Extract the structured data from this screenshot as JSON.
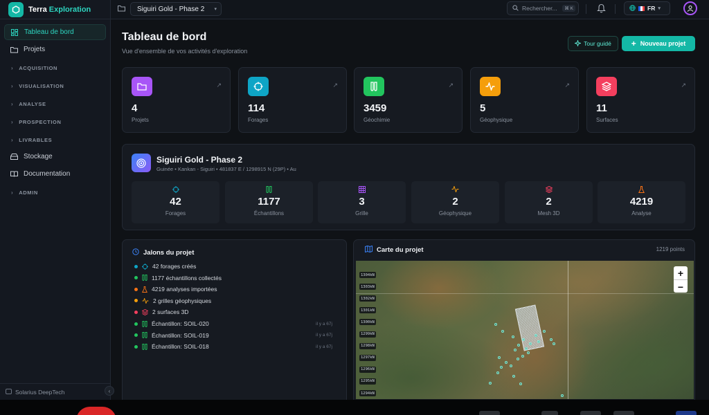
{
  "brand": {
    "name_part1": "Terra",
    "name_part2": "Exploration"
  },
  "sidebar": {
    "items": [
      {
        "label": "Tableau de bord",
        "icon": "dashboard-icon",
        "active": true
      },
      {
        "label": "Projets",
        "icon": "folder-icon",
        "active": false
      }
    ],
    "sections": [
      "ACQUISITION",
      "VISUALISATION",
      "ANALYSE",
      "PROSPECTION",
      "LIVRABLES"
    ],
    "bottom_items": [
      {
        "label": "Stockage",
        "icon": "storage-icon"
      },
      {
        "label": "Documentation",
        "icon": "book-icon"
      }
    ],
    "admin_section": "ADMIN",
    "footer": "Solarius DeepTech"
  },
  "topbar": {
    "project_selector": "Siguiri Gold - Phase 2",
    "search_placeholder": "Rechercher...",
    "search_shortcut": "⌘ K",
    "language": "FR"
  },
  "header": {
    "title": "Tableau de bord",
    "subtitle": "Vue d'ensemble de vos activités d'exploration",
    "tour_button": "Tour guidé",
    "new_project_button": "Nouveau projet"
  },
  "stats": [
    {
      "value": "4",
      "label": "Projets",
      "icon": "folder-icon",
      "color": "#a855f7"
    },
    {
      "value": "114",
      "label": "Forages",
      "icon": "target-icon",
      "color": "#0ea5c6"
    },
    {
      "value": "3459",
      "label": "Géochimie",
      "icon": "sample-tubes-icon",
      "color": "#22c55e"
    },
    {
      "value": "5",
      "label": "Géophysique",
      "icon": "pulse-icon",
      "color": "#f59e0b"
    },
    {
      "value": "11",
      "label": "Surfaces",
      "icon": "layers-icon",
      "color": "#f43f5e"
    }
  ],
  "project": {
    "name": "Siguiri Gold - Phase 2",
    "location": "Guinée • Kankan - Siguiri • 481837 E / 1298915 N (29P) • Au",
    "metrics": [
      {
        "value": "42",
        "label": "Forages",
        "icon": "target-icon",
        "color": "#0ea5c6"
      },
      {
        "value": "1177",
        "label": "Échantillons",
        "icon": "sample-tubes-icon",
        "color": "#22c55e"
      },
      {
        "value": "3",
        "label": "Grille",
        "icon": "grid-icon",
        "color": "#a855f7"
      },
      {
        "value": "2",
        "label": "Géophysique",
        "icon": "pulse-icon",
        "color": "#f59e0b"
      },
      {
        "value": "2",
        "label": "Mesh 3D",
        "icon": "layers-icon",
        "color": "#f43f5e"
      },
      {
        "value": "4219",
        "label": "Analyse",
        "icon": "flask-icon",
        "color": "#f97316"
      }
    ]
  },
  "milestones": {
    "title": "Jalons du projet",
    "items": [
      {
        "text": "42 forages créés",
        "dot": "#0ea5c6",
        "icon": "target-icon",
        "time": ""
      },
      {
        "text": "1177 échantillons collectés",
        "dot": "#22c55e",
        "icon": "sample-tubes-icon",
        "time": ""
      },
      {
        "text": "4219 analyses importées",
        "dot": "#f97316",
        "icon": "flask-icon",
        "time": ""
      },
      {
        "text": "2 grilles géophysiques",
        "dot": "#f59e0b",
        "icon": "pulse-icon",
        "time": ""
      },
      {
        "text": "2 surfaces 3D",
        "dot": "#f43f5e",
        "icon": "layers-icon",
        "time": ""
      },
      {
        "text": "Échantillon: SOIL-020",
        "dot": "#22c55e",
        "icon": "sample-tubes-icon",
        "time": "il y a 67j"
      },
      {
        "text": "Échantillon: SOIL-019",
        "dot": "#22c55e",
        "icon": "sample-tubes-icon",
        "time": "il y a 67j"
      },
      {
        "text": "Échantillon: SOIL-018",
        "dot": "#22c55e",
        "icon": "sample-tubes-icon",
        "time": "il y a 67j"
      }
    ]
  },
  "map": {
    "title": "Carte du projet",
    "points": "1219 points",
    "lat_labels": [
      "1304kN",
      "1303kN",
      "1302kN",
      "1301kN",
      "1300kN",
      "1299kN",
      "1298kN",
      "1297kN",
      "1296kN",
      "1295kN",
      "1294kN"
    ],
    "zoom_in": "+",
    "zoom_out": "−"
  },
  "colors": {
    "accent": "#14b8a6",
    "background": "#0f1216",
    "panel": "#161a21"
  }
}
